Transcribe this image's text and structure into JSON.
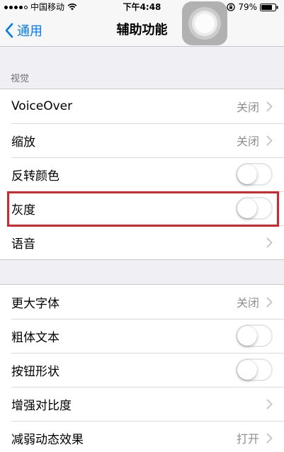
{
  "status_bar": {
    "carrier": "中国移动",
    "time": "下午4:48",
    "battery": "79%"
  },
  "nav": {
    "back_label": "通用",
    "title": "辅助功能"
  },
  "section1": {
    "header": "视觉",
    "rows": [
      {
        "label": "VoiceOver",
        "detail": "关闭"
      },
      {
        "label": "缩放",
        "detail": "关闭"
      },
      {
        "label": "反转颜色"
      },
      {
        "label": "灰度"
      },
      {
        "label": "语音"
      }
    ]
  },
  "section2": {
    "rows": [
      {
        "label": "更大字体",
        "detail": "关闭"
      },
      {
        "label": "粗体文本"
      },
      {
        "label": "按钮形状"
      },
      {
        "label": "增强对比度"
      },
      {
        "label": "减弱动态效果",
        "detail": "打开"
      }
    ]
  },
  "colors": {
    "accent": "#007aff",
    "highlight": "#d7262b"
  }
}
